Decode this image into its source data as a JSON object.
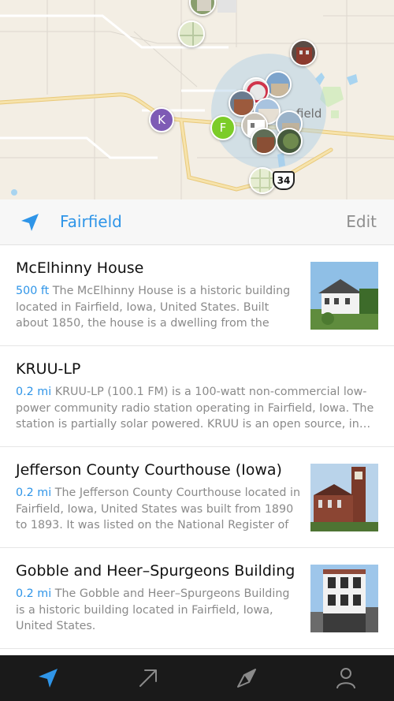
{
  "map": {
    "city_label": "field",
    "pins": [
      {
        "letter": "K",
        "color": "#7e5bb5"
      },
      {
        "letter": "F",
        "color": "#7ccc28"
      }
    ],
    "highway_number": "34"
  },
  "location_bar": {
    "title": "Fairfield",
    "edit_label": "Edit",
    "icon": "location-arrow-icon"
  },
  "items": [
    {
      "title": "McElhinny House",
      "distance": "500 ft",
      "description": "The McElhinny House is a historic building located in Fairfield, Iowa, United States.  Built about 1850, the house is a dwelling from the city'…"
    },
    {
      "title": "KRUU-LP",
      "distance": "0.2 mi",
      "description": "KRUU-LP (100.1 FM) is a 100-watt non-commercial low-power community radio station operating in Fairfield, Iowa. The station is partially solar powered. KRUU is an open source, in…"
    },
    {
      "title": "Jefferson County Courthouse (Iowa)",
      "distance": "0.2 mi",
      "description": "The Jefferson County Courthouse located in Fairfield, Iowa, United States was built from 1890 to 1893. It was listed on the National Register of Hist…"
    },
    {
      "title": "Gobble and Heer–Spurgeons Building",
      "distance": "0.2 mi",
      "description": "The Gobble and Heer–Spurgeons Building is a historic building located in Fairfield, Iowa, United States."
    }
  ],
  "tabbar": {
    "tabs": [
      "location-arrow-icon",
      "arrow-up-right-icon",
      "compass-icon",
      "person-icon"
    ],
    "active_color": "#2f95e8",
    "inactive_color": "#8a8a8a"
  },
  "colors": {
    "accent": "#2f95e8",
    "map_bg": "#f3eee4",
    "road": "#f6d98a"
  }
}
